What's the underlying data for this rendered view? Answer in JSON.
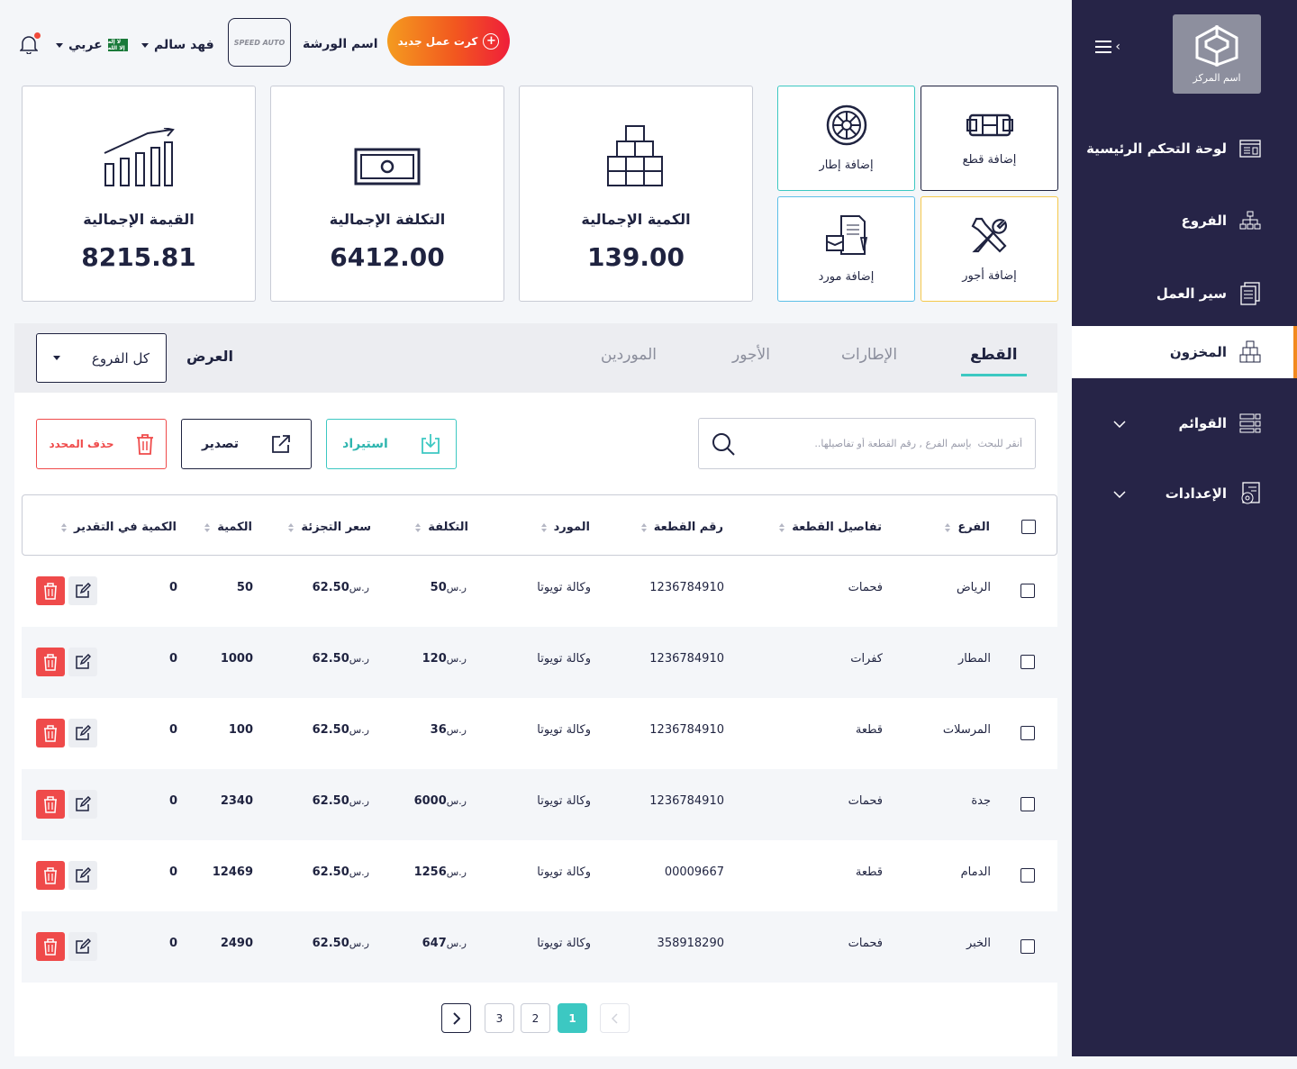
{
  "header": {
    "new_card": "كرت عمل جديد",
    "workshop_name": "اسم الورشة",
    "brand_text": "SPEED AUTO",
    "user_name": "فهد سالم",
    "language": "عربي",
    "flag_text": "ﻻ إله إﻻ الله"
  },
  "sidebar": {
    "logo_label": "اسم المركز",
    "items": [
      {
        "label": "لوحة التحكم الرئيسية"
      },
      {
        "label": "الفروع"
      },
      {
        "label": "سير العمل"
      },
      {
        "label": "المخزون"
      },
      {
        "label": "القوائم"
      },
      {
        "label": "الإعدادات"
      }
    ]
  },
  "stats": [
    {
      "label": "القيمة الإجمالية",
      "value": "8215.81"
    },
    {
      "label": "التكلفة الإجمالية",
      "value": "6412.00"
    },
    {
      "label": "الكمية الإجمالية",
      "value": "139.00"
    }
  ],
  "quick_actions": [
    {
      "label": "إضافة قطع",
      "color": "#1f2340"
    },
    {
      "label": "إضافة إطار",
      "color": "#3cc8c2"
    },
    {
      "label": "إضافة أجور",
      "color": "#f5b400"
    },
    {
      "label": "إضافة مورد",
      "color": "#3cb4e6"
    }
  ],
  "tabs": [
    "القطع",
    "الإطارات",
    "الأجور",
    "الموردين"
  ],
  "view": {
    "label": "العرض",
    "selected": "كل الفروع"
  },
  "search": {
    "placeholder": "أنقر للبحث  بإسم الفرع , رقم القطعة أو تفاصيلها.."
  },
  "actions": {
    "import": "استيراد",
    "export": "تصدير",
    "delete_selected": "حذف المحدد"
  },
  "table": {
    "columns": [
      "الفرع",
      "تفاصيل القطعة",
      "رقم القطعة",
      "المورد",
      "التكلفة",
      "سعر التجزئة",
      "الكمية",
      "الكمية في التقدير"
    ],
    "currency": "ر.س",
    "rows": [
      {
        "branch": "الرياض",
        "details": "فحمات",
        "part_no": "1236784910",
        "supplier": "وكالة تويوتا",
        "cost": "50",
        "retail": "62.50",
        "qty": "50",
        "est_qty": "0"
      },
      {
        "branch": "المطار",
        "details": "كفرات",
        "part_no": "1236784910",
        "supplier": "وكالة تويوتا",
        "cost": "120",
        "retail": "62.50",
        "qty": "1000",
        "est_qty": "0"
      },
      {
        "branch": "المرسلات",
        "details": "قطعة",
        "part_no": "1236784910",
        "supplier": "وكالة تويوتا",
        "cost": "36",
        "retail": "62.50",
        "qty": "100",
        "est_qty": "0"
      },
      {
        "branch": "جدة",
        "details": "فحمات",
        "part_no": "1236784910",
        "supplier": "وكالة تويوتا",
        "cost": "6000",
        "retail": "62.50",
        "qty": "2340",
        "est_qty": "0"
      },
      {
        "branch": "الدمام",
        "details": "قطعة",
        "part_no": "00009667",
        "supplier": "وكالة تويوتا",
        "cost": "1256",
        "retail": "62.50",
        "qty": "12469",
        "est_qty": "0"
      },
      {
        "branch": "الخبر",
        "details": "فحمات",
        "part_no": "358918290",
        "supplier": "وكالة تويوتا",
        "cost": "647",
        "retail": "62.50",
        "qty": "2490",
        "est_qty": "0"
      }
    ]
  },
  "pagination": {
    "pages": [
      "1",
      "2",
      "3"
    ],
    "current": "1"
  },
  "colors": {
    "sidebar": "#262447",
    "accent": "#3cc8c2",
    "danger": "#ef4a4a",
    "orange": "#f28a1f"
  }
}
